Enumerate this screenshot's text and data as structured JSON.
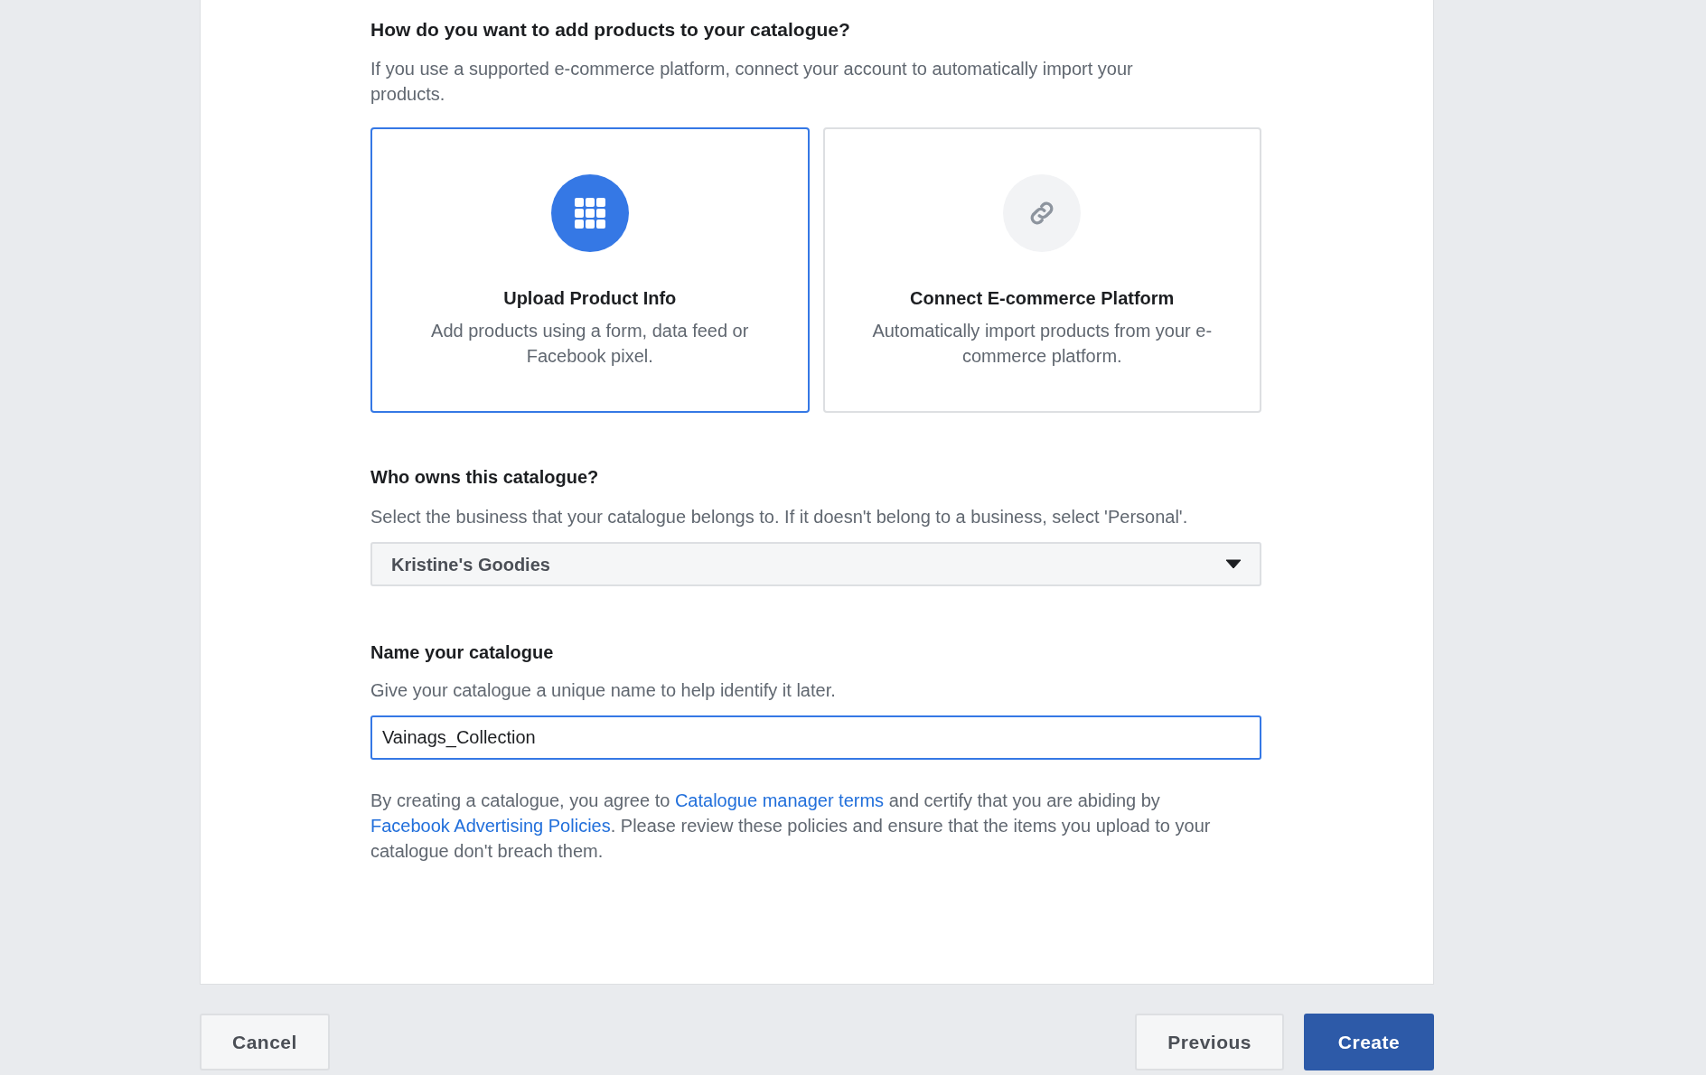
{
  "source_section": {
    "heading": "How do you want to add products to your catalogue?",
    "description": "If you use a supported e-commerce platform, connect your account to automatically import your products.",
    "options": [
      {
        "kind": "upload",
        "title": "Upload Product Info",
        "description": "Add products using a form, data feed or Facebook pixel.",
        "selected": true
      },
      {
        "kind": "connect",
        "title": "Connect E-commerce Platform",
        "description": "Automatically import products from your e-commerce platform.",
        "selected": false
      }
    ]
  },
  "owner_section": {
    "heading": "Who owns this catalogue?",
    "description": "Select the business that your catalogue belongs to. If it doesn't belong to a business, select 'Personal'.",
    "dropdown": {
      "value": "Kristine's Goodies"
    }
  },
  "name_section": {
    "heading": "Name your catalogue",
    "description": "Give your catalogue a unique name to help identify it later.",
    "input": {
      "value": "Vainags_Collection"
    }
  },
  "legal": [
    {
      "kind": "text",
      "text": "By creating a catalogue, you agree to "
    },
    {
      "kind": "link",
      "text": "Catalogue manager terms"
    },
    {
      "kind": "text",
      "text": " and certify that you are abiding by "
    },
    {
      "kind": "link",
      "text": "Facebook Advertising Policies"
    },
    {
      "kind": "text",
      "text": ". Please review these policies and ensure that the items you upload to your catalogue don't breach them."
    }
  ],
  "footer": {
    "left": [
      {
        "label": "Cancel",
        "kind": "secondary"
      }
    ],
    "right": [
      {
        "label": "Previous",
        "kind": "secondary"
      },
      {
        "label": "Create",
        "kind": "primary"
      }
    ]
  }
}
